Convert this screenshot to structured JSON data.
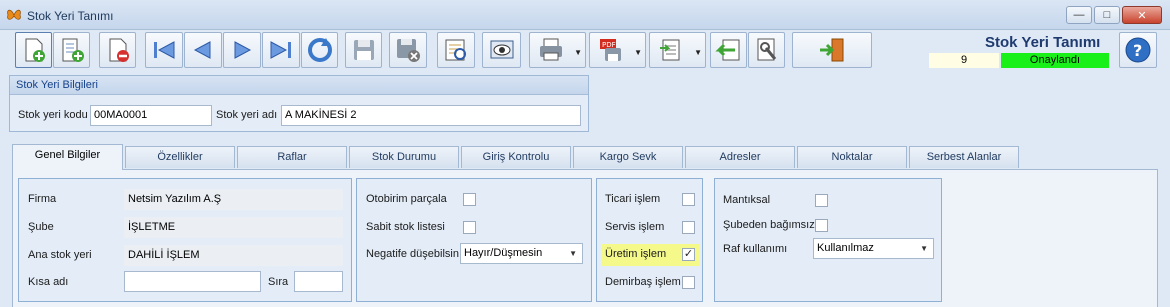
{
  "window": {
    "title": "Stok Yeri Tanımı"
  },
  "header": {
    "form_title": "Stok Yeri Tanımı",
    "record_no": "9",
    "status": "Onaylandı",
    "status_color": "#19f019"
  },
  "toolbar": {
    "buttons": [
      "new-icon",
      "new-sub-icon",
      "delete-icon",
      "first-record-icon",
      "previous-record-icon",
      "next-record-icon",
      "last-record-icon",
      "refresh-icon",
      "save-icon",
      "save-cancel-icon",
      "preview-icon",
      "view-icon",
      "print-icon",
      "pdf-export-icon",
      "import-icon",
      "back-icon",
      "settings-icon",
      "exit-icon",
      "help-icon"
    ]
  },
  "group": {
    "title": "Stok Yeri Bilgileri",
    "code_label": "Stok yeri kodu",
    "code_value": "00MA0001",
    "name_label": "Stok yeri adı",
    "name_value": "A MAKİNESİ 2"
  },
  "tabs": [
    "Genel Bilgiler",
    "Özellikler",
    "Raflar",
    "Stok Durumu",
    "Giriş Kontrolu",
    "Kargo Sevk",
    "Adresler",
    "Noktalar",
    "Serbest Alanlar"
  ],
  "active_tab": "Genel Bilgiler",
  "general": {
    "firma_label": "Firma",
    "firma_value": "Netsim Yazılım A.Ş",
    "sube_label": "Şube",
    "sube_value": "İŞLETME",
    "ana_label": "Ana stok yeri",
    "ana_value": "DAHİLİ İŞLEM",
    "kisa_label": "Kısa adı",
    "kisa_value": "",
    "sira_label": "Sıra",
    "sira_value": ""
  },
  "stock": {
    "otobirim_label": "Otobirim parçala",
    "otobirim_checked": false,
    "sabit_label": "Sabit stok listesi",
    "sabit_checked": false,
    "negatif_label": "Negatife düşebilsin",
    "negatif_value": "Hayır/Düşmesin"
  },
  "islem": {
    "ticari_label": "Ticari işlem",
    "ticari_checked": false,
    "servis_label": "Servis işlem",
    "servis_checked": false,
    "uretim_label": "Üretim işlem",
    "uretim_checked": true,
    "demirbas_label": "Demirbaş işlem",
    "demirbas_checked": false,
    "highlight_color": "#f4f98a"
  },
  "misc": {
    "mantiksal_label": "Mantıksal",
    "mantiksal_checked": false,
    "subeden_label": "Şubeden bağımsız",
    "subeden_checked": false,
    "raf_label": "Raf kullanımı",
    "raf_value": "Kullanılmaz"
  }
}
